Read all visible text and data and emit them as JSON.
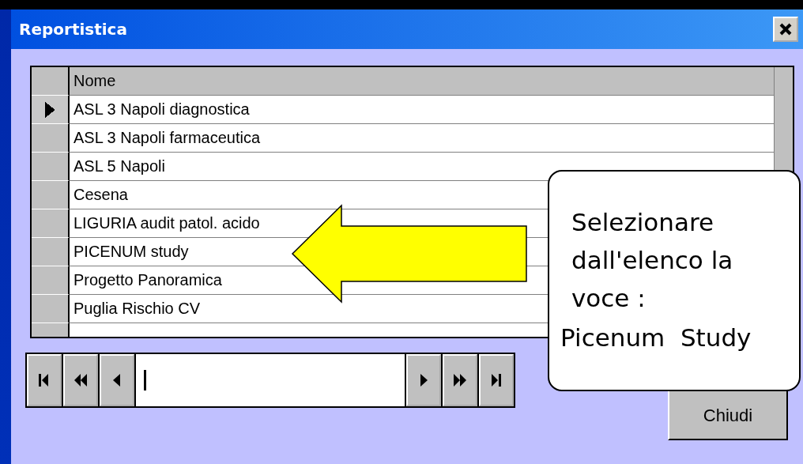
{
  "window": {
    "title": "Reportistica"
  },
  "grid": {
    "columns": [
      "Nome"
    ],
    "rows": [
      {
        "name": "ASL 3 Napoli diagnostica",
        "selected": true
      },
      {
        "name": "ASL 3 Napoli farmaceutica",
        "selected": false
      },
      {
        "name": "ASL 5 Napoli",
        "selected": false
      },
      {
        "name": "Cesena",
        "selected": false
      },
      {
        "name": "LIGURIA audit patol. acido",
        "selected": false
      },
      {
        "name": "PICENUM study",
        "selected": false
      },
      {
        "name": "Progetto Panoramica",
        "selected": false
      },
      {
        "name": "Puglia Rischio CV",
        "selected": false
      }
    ]
  },
  "navigator": {
    "buttons": [
      {
        "kind": "first"
      },
      {
        "kind": "prev-page"
      },
      {
        "kind": "prev"
      },
      {
        "kind": "field"
      },
      {
        "kind": "next"
      },
      {
        "kind": "next-page"
      },
      {
        "kind": "last"
      }
    ]
  },
  "close_button": "Chiudi",
  "callout": {
    "lines": [
      "Selezionare dall'elenco la voce :"
    ],
    "highlight": "Picenum  Study"
  }
}
